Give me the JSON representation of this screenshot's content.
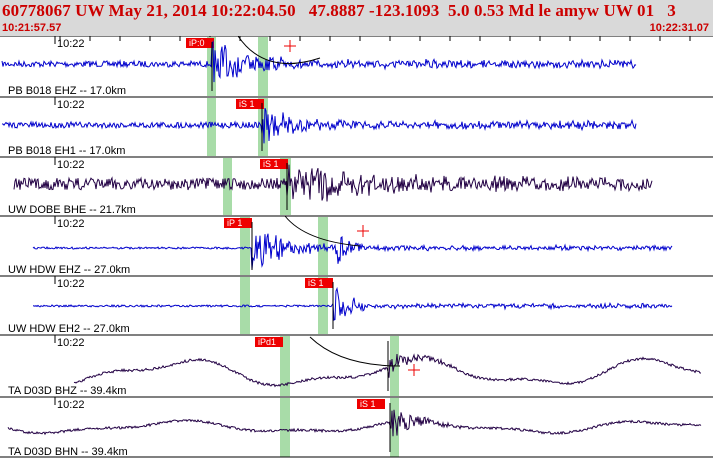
{
  "header": {
    "title": "60778067 UW May 21, 2014 10:22:04.50   47.8887 -123.1093  5.0 0.53 Md le amyw UW 01   3",
    "start_time": "10:21:57.57",
    "end_time": "10:22:31.07"
  },
  "colors": {
    "header_text": "#cc0000",
    "header_bg": "#d9d9d9",
    "trace_blue": "#0000cc",
    "trace_dark": "#220044",
    "pick_box": "#ee0000",
    "window_green": "#a8dca8",
    "grid": "#000000"
  },
  "traces": [
    {
      "label": "PB B018 EHZ -- 17.0km",
      "minute": "10:22",
      "pick_label": "iP:0",
      "trace_color": "blue"
    },
    {
      "label": "PB B018 EH1 -- 17.0km",
      "minute": "10:22",
      "pick_label": "iS 1",
      "trace_color": "blue"
    },
    {
      "label": "UW DOBE BHE -- 21.7km",
      "minute": "10:22",
      "pick_label": "iS 1",
      "trace_color": "dark"
    },
    {
      "label": "UW HDW EHZ -- 27.0km",
      "minute": "10:22",
      "pick_label": "iP 1",
      "trace_color": "blue"
    },
    {
      "label": "UW HDW EH2 -- 27.0km",
      "minute": "10:22",
      "pick_label": "iS 1",
      "trace_color": "blue"
    },
    {
      "label": "TA D03D BHZ -- 39.4km",
      "minute": "10:22",
      "pick_label": "iPd1",
      "trace_color": "dark"
    },
    {
      "label": "TA D03D BHN -- 39.4km",
      "minute": "10:22",
      "pick_label": "iS 1",
      "trace_color": "dark"
    }
  ]
}
